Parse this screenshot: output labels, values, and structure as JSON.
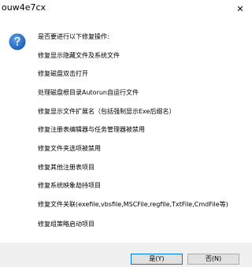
{
  "window": {
    "title": "ouw4e7cx",
    "close_glyph": "✕"
  },
  "dialog": {
    "icon": "question-icon",
    "lines": [
      "是否要进行以下修复操作:",
      "修复显示隐藏文件及系统文件",
      "修复磁盘双击打开",
      "处理磁盘根目录Autorun自运行文件",
      "修复显示文件扩展名（包括强制显示Exe后缀名）",
      "修复注册表编辑器与任务管理器被禁用",
      "修复文件夹选项被禁用",
      "修复其他注册表项目",
      "修复系统映象劫持项目",
      "修复文件关联(exefile,vbsfile,MSCFile,regfile,TxtFile,CmdFile等)",
      "修复组策略启动项目"
    ]
  },
  "buttons": {
    "yes_label": "是(Y)",
    "no_label": "否(N)"
  },
  "colors": {
    "icon_blue": "#1a5fb4",
    "default_border": "#0078d7",
    "footer_bg": "#f0f0f0"
  }
}
